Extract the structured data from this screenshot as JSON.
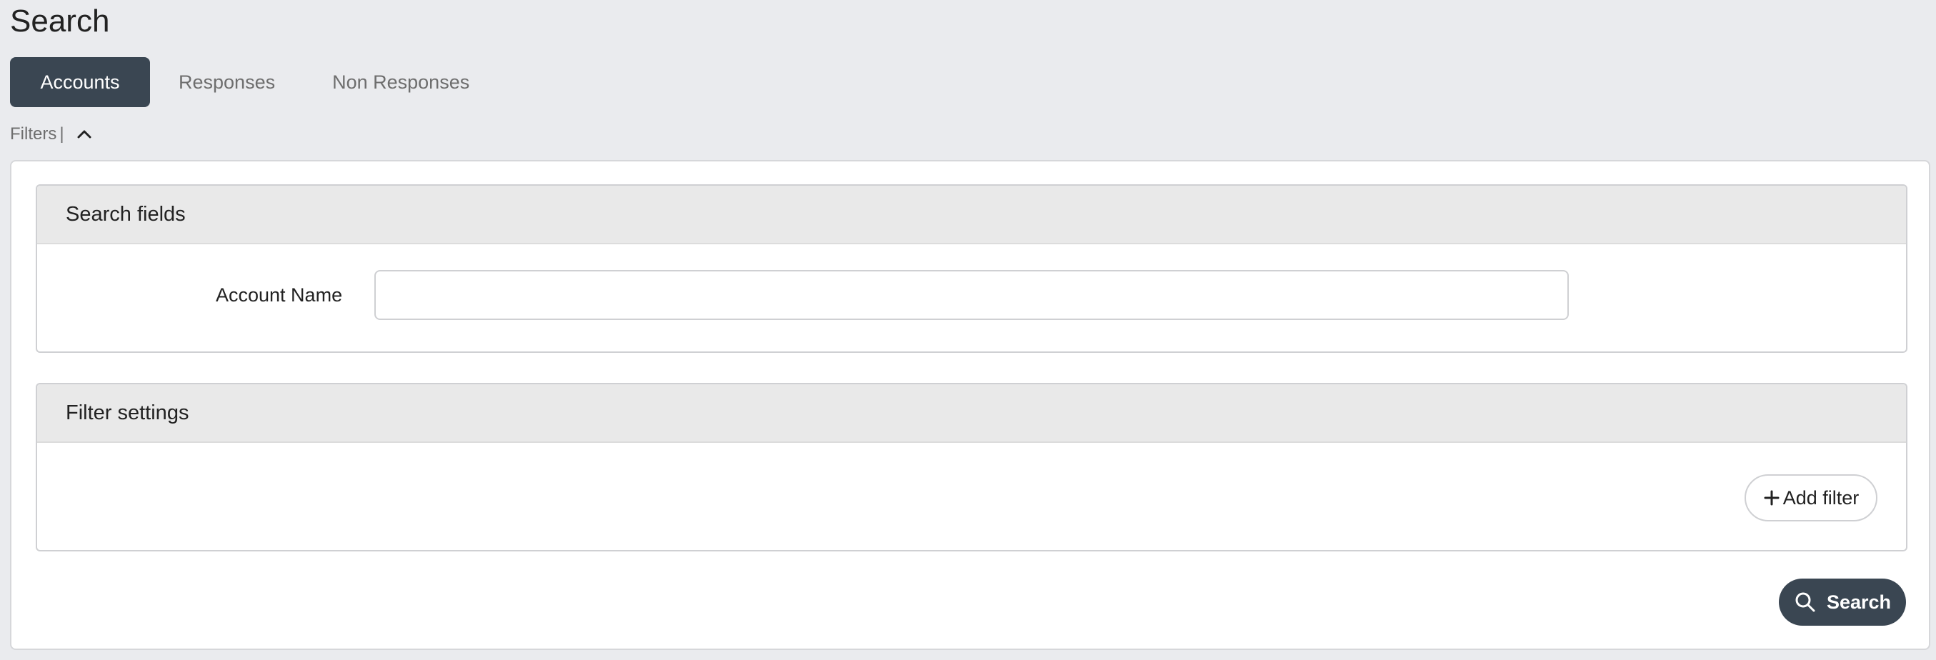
{
  "page": {
    "title": "Search"
  },
  "tabs": [
    {
      "label": "Accounts",
      "active": true
    },
    {
      "label": "Responses",
      "active": false
    },
    {
      "label": "Non Responses",
      "active": false
    }
  ],
  "filters": {
    "label": "Filters",
    "separator": "|",
    "icon": "chevron-up-icon",
    "expanded": true
  },
  "search_fields": {
    "title": "Search fields",
    "account_name": {
      "label": "Account Name",
      "value": "",
      "placeholder": ""
    }
  },
  "filter_settings": {
    "title": "Filter settings",
    "add_filter_label": "Add filter",
    "add_filter_icon": "plus-icon"
  },
  "search_button": {
    "label": "Search",
    "icon": "search-icon"
  },
  "colors": {
    "accent": "#3a4652",
    "background": "#eaebee",
    "panel_header": "#e9e9e9"
  }
}
